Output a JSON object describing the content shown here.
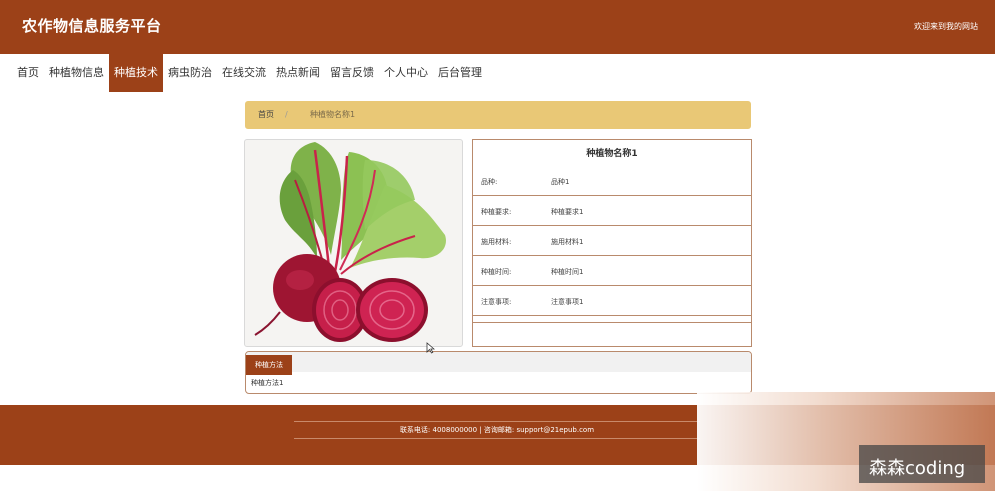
{
  "header": {
    "title": "农作物信息服务平台",
    "welcome": "欢迎来到我的网站"
  },
  "nav": {
    "items": [
      {
        "label": "首页"
      },
      {
        "label": "种植物信息"
      },
      {
        "label": "种植技术",
        "active": true
      },
      {
        "label": "病虫防治"
      },
      {
        "label": "在线交流"
      },
      {
        "label": "热点新闻"
      },
      {
        "label": "留言反馈"
      },
      {
        "label": "个人中心"
      },
      {
        "label": "后台管理"
      }
    ]
  },
  "breadcrumb": {
    "home": "首页",
    "separator": "/",
    "current": "种植物名称1"
  },
  "detail": {
    "title": "种植物名称1",
    "image": "beetroot-image",
    "rows": [
      {
        "label": "品种:",
        "value": "品种1"
      },
      {
        "label": "种植要求:",
        "value": "种植要求1"
      },
      {
        "label": "施用材料:",
        "value": "施用材料1"
      },
      {
        "label": "种植时间:",
        "value": "种植时间1"
      },
      {
        "label": "注意事项:",
        "value": "注意事项1"
      }
    ]
  },
  "tabs": {
    "active_label": "种植方法",
    "content": "种植方法1"
  },
  "footer": {
    "contact": "联系电话: 4008000000 | 咨询邮箱: support@21epub.com"
  },
  "watermark": {
    "text": "森森coding"
  },
  "colors": {
    "brand": "#9c4118",
    "breadcrumb_bg": "#e9c876",
    "border": "#b98a6c"
  }
}
